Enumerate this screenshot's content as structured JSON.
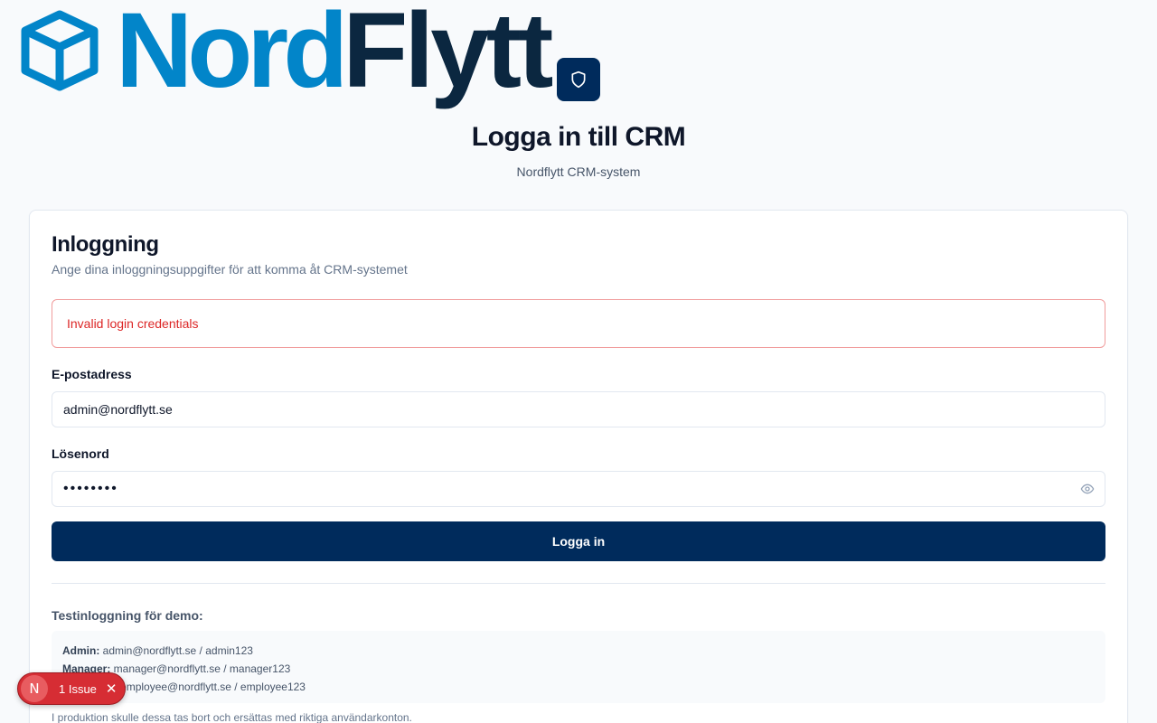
{
  "logo": {
    "part1": "Nord",
    "part2": "Flytt"
  },
  "header": {
    "title": "Logga in till CRM",
    "subtitle": "Nordflytt CRM-system"
  },
  "card": {
    "title": "Inloggning",
    "description": "Ange dina inloggningsuppgifter för att komma åt CRM-systemet",
    "error": "Invalid login credentials",
    "email_label": "E-postadress",
    "email_value": "admin@nordflytt.se",
    "password_label": "Lösenord",
    "password_value": "••••••••",
    "submit_label": "Logga in",
    "demo_heading": "Testinloggning för demo:",
    "demo_accounts": [
      {
        "role": "Admin:",
        "credentials": " admin@nordflytt.se / admin123"
      },
      {
        "role": "Manager:",
        "credentials": " manager@nordflytt.se / manager123"
      },
      {
        "role": "Employee:",
        "credentials": " employee@nordflytt.se / employee123"
      }
    ],
    "demo_note": "I produktion skulle dessa tas bort och ersättas med riktiga användarkonton."
  },
  "issues": {
    "letter": "N",
    "label": "1 Issue",
    "close": "✕"
  },
  "colors": {
    "brand_blue": "#0285c9",
    "brand_dark": "#0b2740",
    "primary_button": "#002b5c",
    "error": "#dc2626"
  },
  "icons": [
    "cube-logo-icon",
    "shield-icon",
    "eye-icon",
    "close-icon"
  ]
}
